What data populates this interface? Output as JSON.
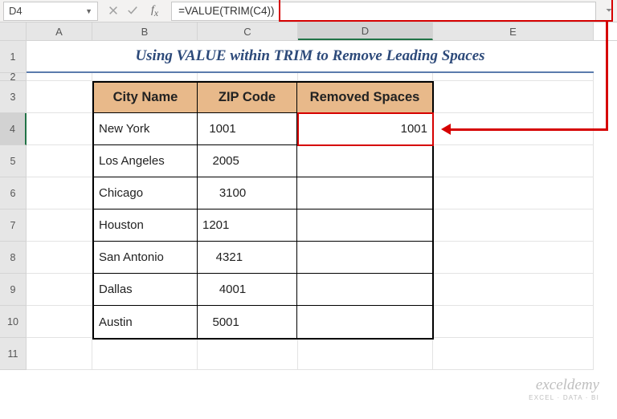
{
  "nameBox": "D4",
  "formula": "=VALUE(TRIM(C4))",
  "columns": [
    "A",
    "B",
    "C",
    "D",
    "E"
  ],
  "selectedColumn": "D",
  "rowNums": [
    1,
    2,
    3,
    4,
    5,
    6,
    7,
    8,
    9,
    10,
    11
  ],
  "selectedRow": 4,
  "title": "Using VALUE within TRIM to Remove Leading Spaces",
  "headers": {
    "city": "City Name",
    "zip": "ZIP Code",
    "removed": "Removed Spaces"
  },
  "rows": [
    {
      "city": "New York",
      "zip": "  1001",
      "removed": "1001"
    },
    {
      "city": "Los Angeles",
      "zip": "   2005",
      "removed": ""
    },
    {
      "city": "Chicago",
      "zip": "     3100",
      "removed": ""
    },
    {
      "city": "Houston",
      "zip": "1201",
      "removed": ""
    },
    {
      "city": "San Antonio",
      "zip": "    4321",
      "removed": ""
    },
    {
      "city": "Dallas",
      "zip": "     4001",
      "removed": ""
    },
    {
      "city": "Austin",
      "zip": "   5001",
      "removed": ""
    }
  ],
  "watermark": {
    "l1": "exceldemy",
    "l2": "Excel · Data · BI"
  }
}
